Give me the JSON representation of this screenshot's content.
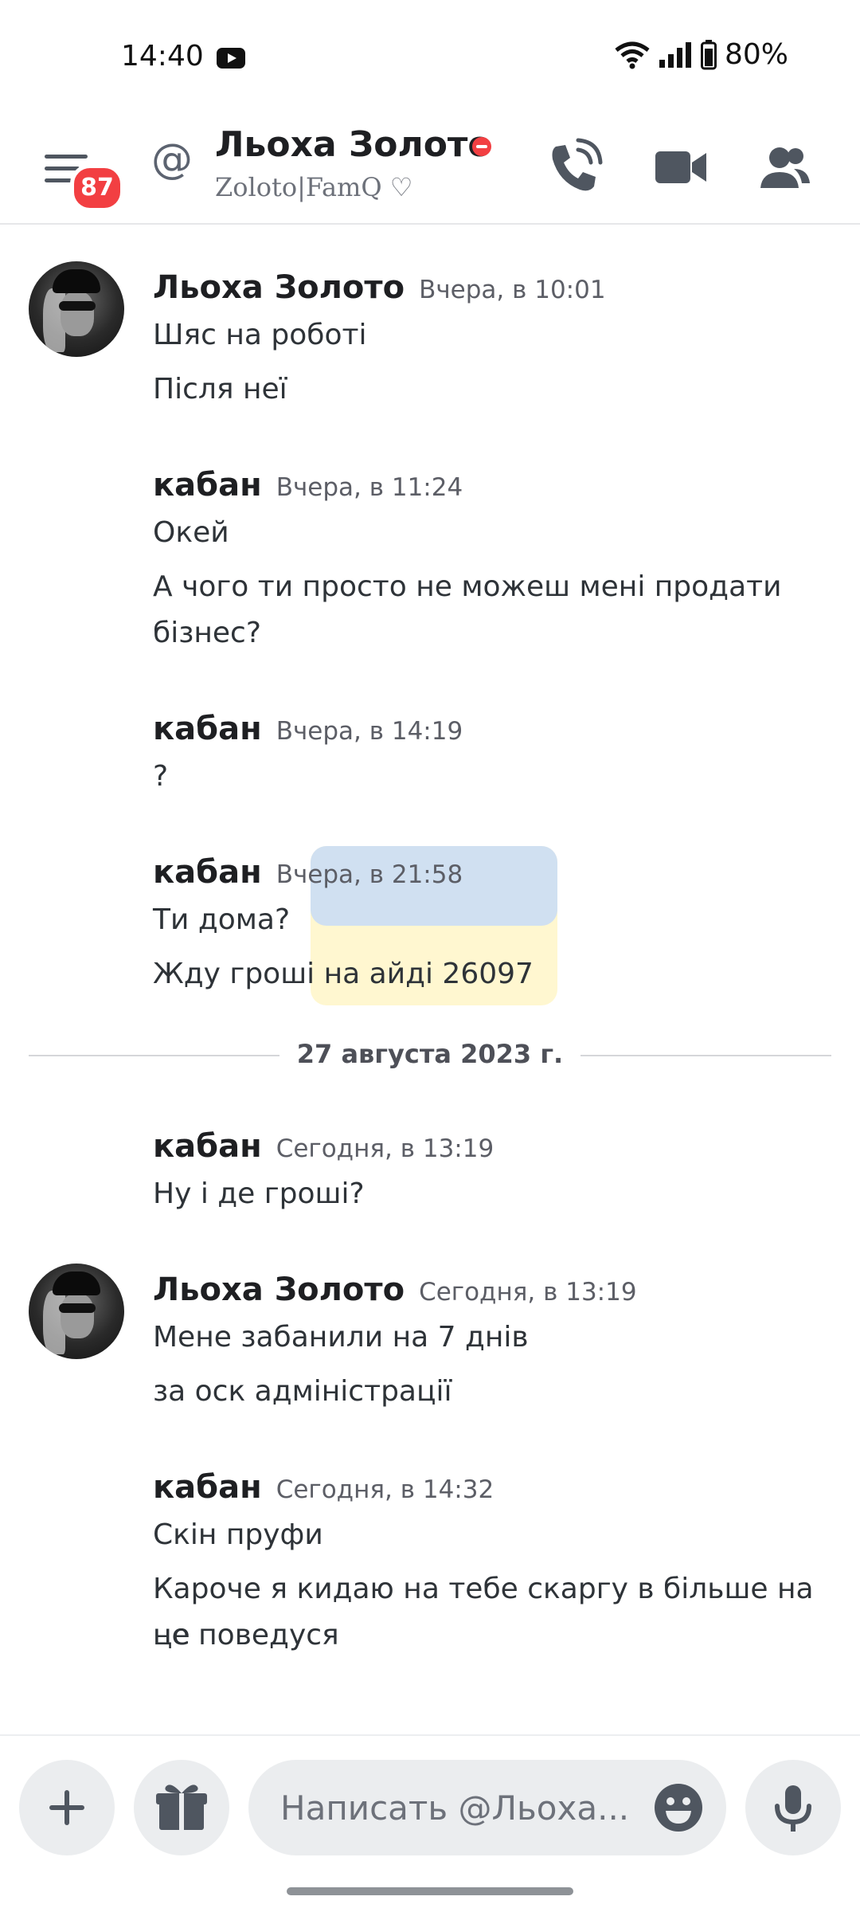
{
  "status_bar": {
    "time": "14:40",
    "battery": "80%"
  },
  "header": {
    "notification_count": "87",
    "at_symbol": "@",
    "title": "Льоха Золото",
    "subtitle": "Zoloto|FamQ ♡"
  },
  "messages": [
    {
      "author": "Льоха Золото",
      "time": "Вчера, в 10:01",
      "lines": [
        "Шяс на роботі",
        "Після неї"
      ]
    },
    {
      "author": "кабан",
      "time": "Вчера, в 11:24",
      "lines": [
        "Окей",
        "А чого ти просто не можеш мені продати",
        "бізнес?"
      ]
    },
    {
      "author": "кабан",
      "time": "Вчера, в 14:19",
      "lines": [
        "?"
      ]
    },
    {
      "author": "кабан",
      "time": "Вчера, в 21:58",
      "lines": [
        "Ти дома?",
        "Жду гроші на айді 26097"
      ]
    },
    {
      "author": "кабан",
      "time": "Сегодня, в 13:19",
      "lines": [
        "Ну і де гроші?"
      ]
    },
    {
      "author": "Льоха Золото",
      "time": "Сегодня, в 13:19",
      "lines": [
        "Мене забанили на 7 днів",
        "за оск адміністрації"
      ]
    },
    {
      "author": "кабан",
      "time": "Сегодня, в 14:32",
      "lines": [
        "Скін пруфи",
        "Кароче я кидаю на тебе скаргу в більше на це",
        "не поведуся"
      ]
    }
  ],
  "date_divider": "27 августа 2023 г.",
  "composer": {
    "placeholder": "Написать @Льоха..."
  },
  "colors": {
    "accent_red": "#f23f42",
    "background": "#ffffff",
    "text": "#2e3338"
  }
}
